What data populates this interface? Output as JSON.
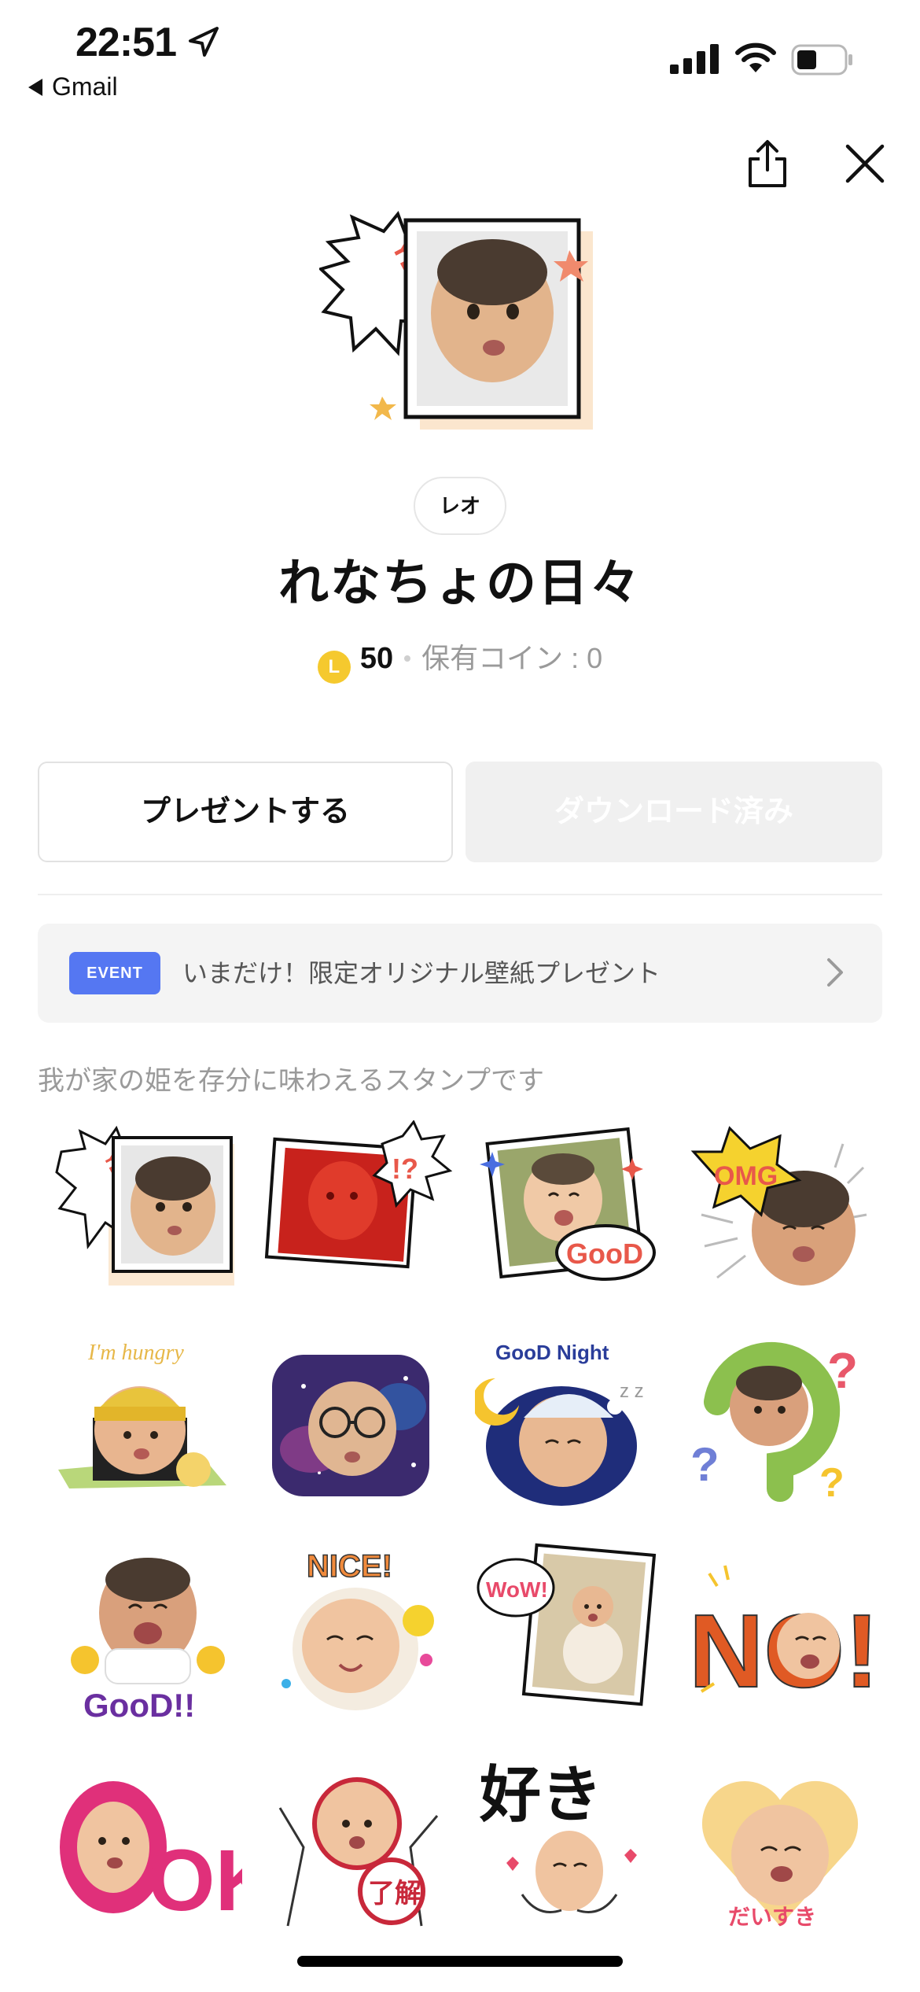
{
  "status_bar": {
    "time": "22:51",
    "back_app": "Gmail"
  },
  "header": {
    "share_icon": "share-icon",
    "close_icon": "close-icon"
  },
  "product": {
    "author": "レオ",
    "title": "れなちょの日々",
    "coin_symbol": "L",
    "price": "50",
    "coins_owned": "保有コイン : 0",
    "description": "我が家の姫を存分に味わえるスタンプです"
  },
  "actions": {
    "present_label": "プレゼントする",
    "download_label": "ダウンロード済み"
  },
  "event": {
    "badge": "EVENT",
    "text": "いまだけ！限定オリジナル壁紙プレゼント"
  },
  "stickers": [
    {
      "caption": "YEAH!"
    },
    {
      "caption": "!?"
    },
    {
      "caption": "GooD"
    },
    {
      "caption": "OMG"
    },
    {
      "caption": "I'm hungry"
    },
    {
      "caption": ""
    },
    {
      "caption": "GooD Night"
    },
    {
      "caption": "?"
    },
    {
      "caption": "GooD!!"
    },
    {
      "caption": "NICE!"
    },
    {
      "caption": "WoW!"
    },
    {
      "caption": "NO!"
    },
    {
      "caption": "OK!"
    },
    {
      "caption": "了解"
    },
    {
      "caption": "好き"
    },
    {
      "caption": "だいすき"
    }
  ],
  "colors": {
    "accent_blue": "#5577f2",
    "coin_yellow": "#f5c92e",
    "muted_text": "#9a9a9a"
  }
}
